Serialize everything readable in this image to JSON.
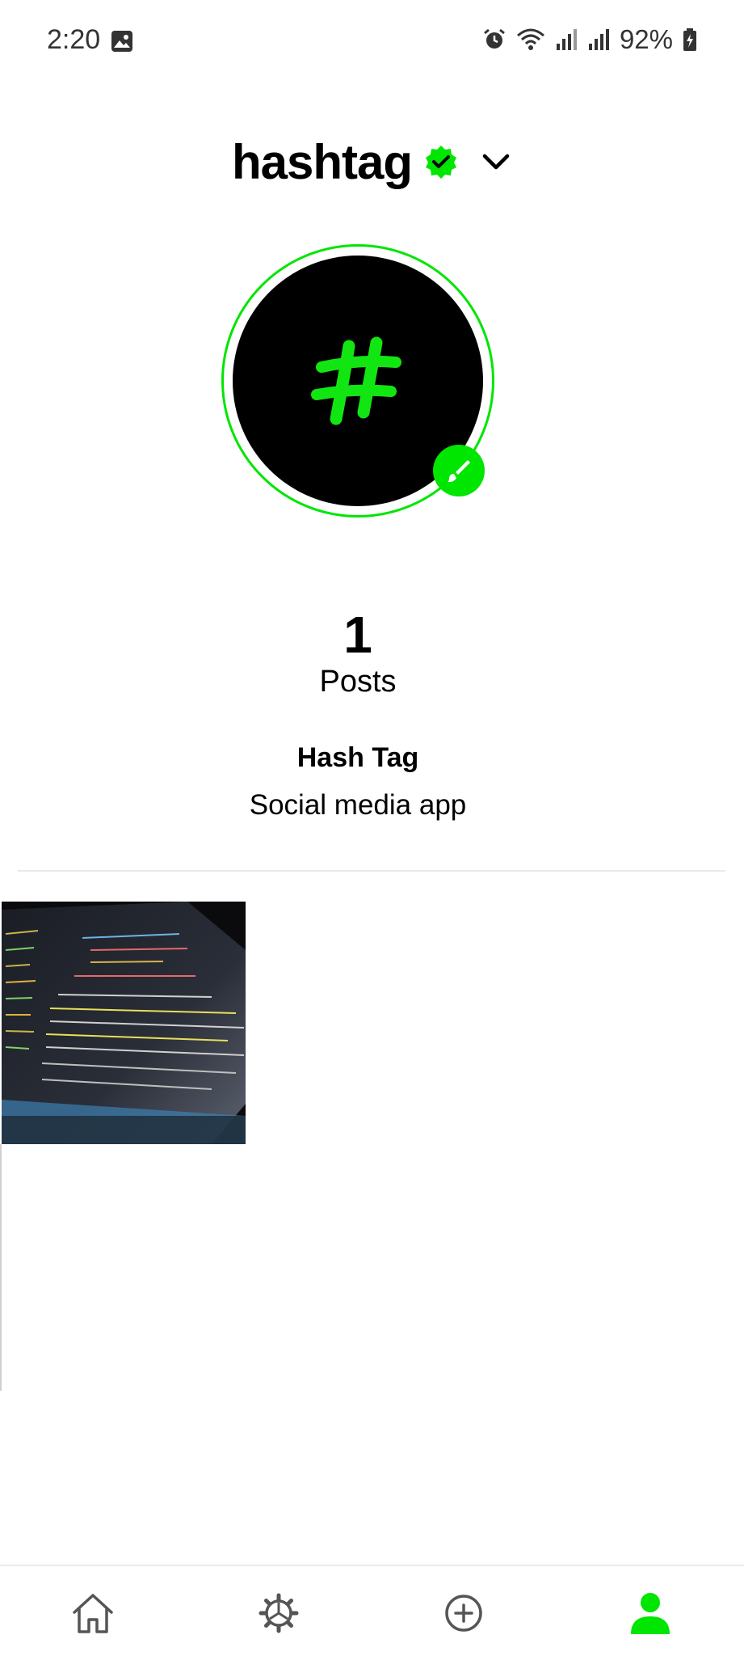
{
  "status_bar": {
    "time": "2:20",
    "battery": "92%",
    "icons": [
      "gallery-icon",
      "alarm-icon",
      "wifi-icon",
      "signal-icon",
      "signal-icon",
      "battery-icon"
    ]
  },
  "profile": {
    "username": "hashtag",
    "posts_count": "1",
    "posts_label": "Posts",
    "display_name": "Hash Tag",
    "bio": "Social media app"
  },
  "nav": {
    "items": [
      "home-icon",
      "settings-icon",
      "add-post-icon",
      "profile-icon"
    ],
    "active": "profile-icon"
  },
  "colors": {
    "accent": "#00e600",
    "avatar_bg": "#000000",
    "text": "#000000",
    "inactive_icon": "#555555"
  }
}
